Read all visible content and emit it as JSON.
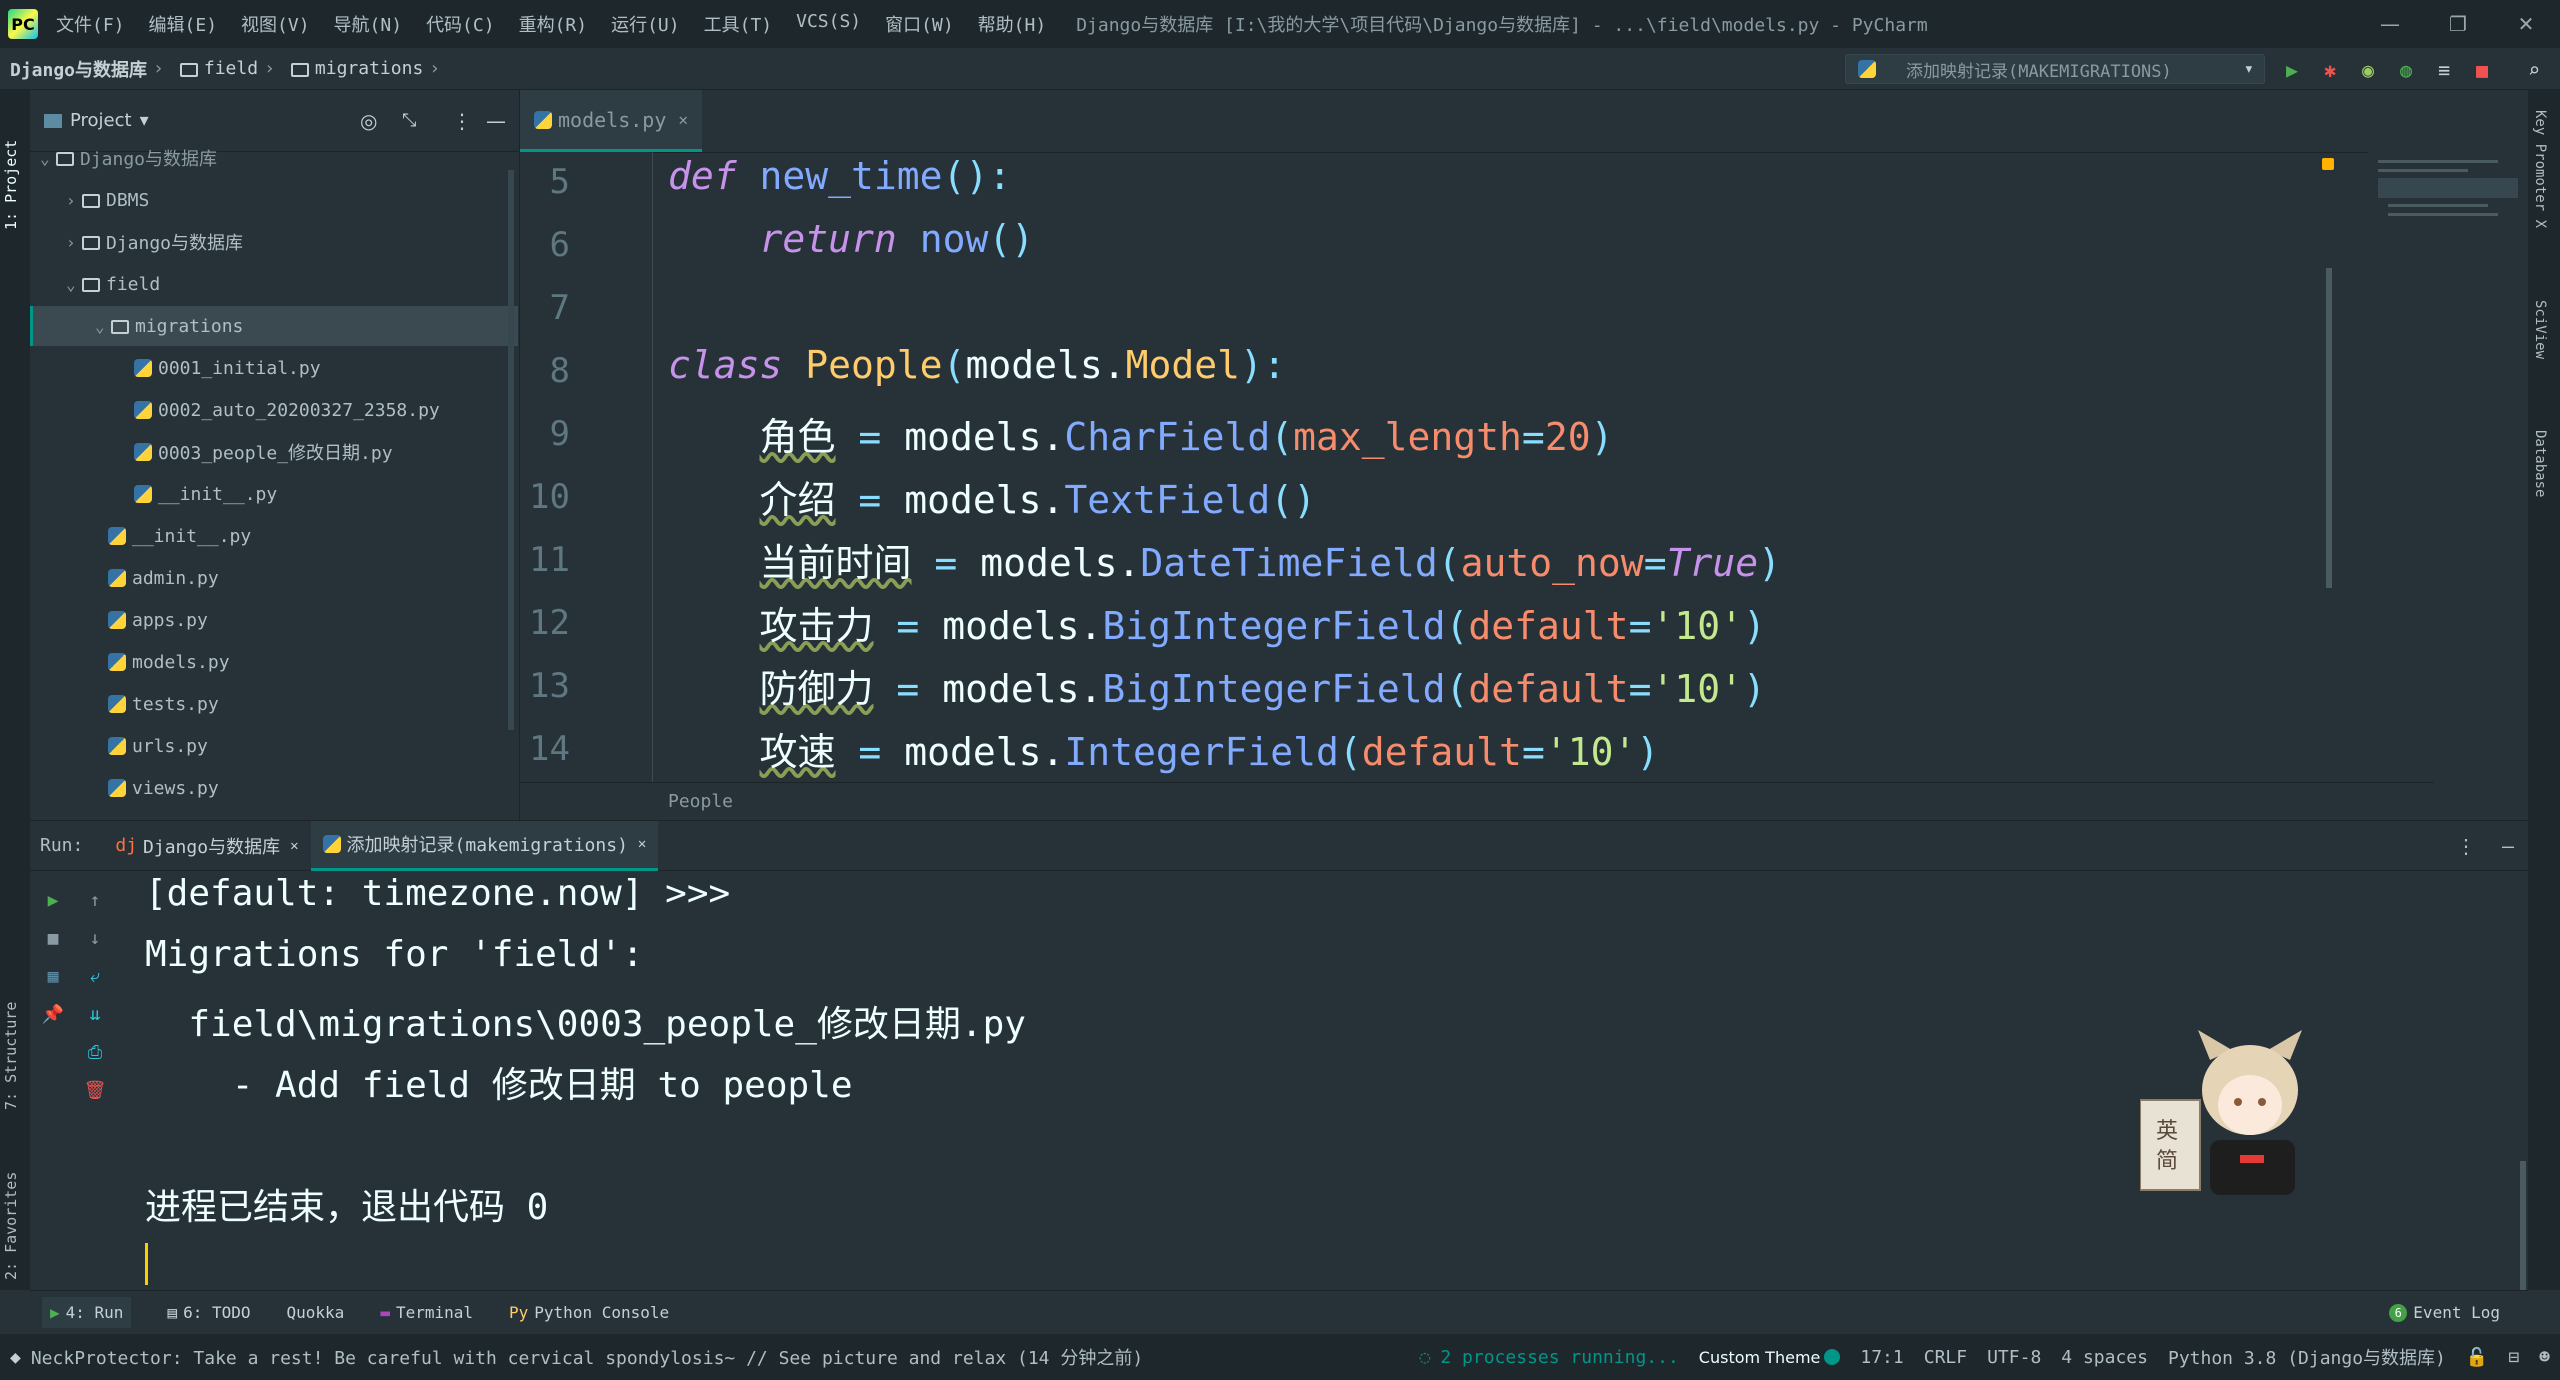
{
  "titlebar": {
    "menus": [
      "文件(F)",
      "编辑(E)",
      "视图(V)",
      "导航(N)",
      "代码(C)",
      "重构(R)",
      "运行(U)",
      "工具(T)",
      "VCS(S)",
      "窗口(W)",
      "帮助(H)"
    ],
    "title": "Django与数据库 [I:\\我的大学\\项目代码\\Django与数据库] - ...\\field\\models.py - PyCharm",
    "btn_min": "—",
    "btn_max": "❐",
    "btn_close": "✕"
  },
  "navbar": {
    "crumbs": [
      "Django与数据库",
      "field",
      "migrations"
    ],
    "run_config": "添加映射记录(MAKEMIGRATIONS)"
  },
  "left_strip": {
    "project_tab": "1: Project",
    "structure_tab": "7: Structure",
    "favorites_tab": "2: Favorites"
  },
  "right_strip": {
    "key_promoter": "Key Promoter X",
    "sciview": "SciView",
    "database": "Database"
  },
  "project": {
    "header": "Project",
    "root": "Django与数据库",
    "items": [
      {
        "label": "DBMS",
        "type": "folder",
        "level": 1,
        "open": false
      },
      {
        "label": "Django与数据库",
        "type": "folder",
        "level": 1,
        "open": false
      },
      {
        "label": "field",
        "type": "folder",
        "level": 1,
        "open": true
      },
      {
        "label": "migrations",
        "type": "folder",
        "level": 2,
        "open": true,
        "selected": true
      },
      {
        "label": "0001_initial.py",
        "type": "py",
        "level": 3
      },
      {
        "label": "0002_auto_20200327_2358.py",
        "type": "py",
        "level": 3
      },
      {
        "label": "0003_people_修改日期.py",
        "type": "py",
        "level": 3
      },
      {
        "label": "__init__.py",
        "type": "py",
        "level": 3
      },
      {
        "label": "__init__.py",
        "type": "py",
        "level": 2
      },
      {
        "label": "admin.py",
        "type": "py",
        "level": 2
      },
      {
        "label": "apps.py",
        "type": "py",
        "level": 2
      },
      {
        "label": "models.py",
        "type": "py",
        "level": 2
      },
      {
        "label": "tests.py",
        "type": "py",
        "level": 2
      },
      {
        "label": "urls.py",
        "type": "py",
        "level": 2
      },
      {
        "label": "views.py",
        "type": "py",
        "level": 2
      }
    ]
  },
  "editor": {
    "tab": "models.py",
    "line_numbers": [
      "5",
      "6",
      "7",
      "8",
      "9",
      "10",
      "11",
      "12",
      "13",
      "14"
    ],
    "breadcrumb": "People"
  },
  "run": {
    "label": "Run:",
    "tabs": [
      "Django与数据库",
      "添加映射记录(makemigrations)"
    ],
    "output": [
      "[default: timezone.now] >>>",
      "Migrations for 'field':",
      "  field\\migrations\\0003_people_修改日期.py",
      "    - Add field 修改日期 to people",
      "",
      "进程已结束，退出代码 0"
    ]
  },
  "bottom_tabs": {
    "run": "4: Run",
    "todo": "6: TODO",
    "quokka": "Quokka",
    "terminal": "Terminal",
    "python_console": "Python Console",
    "event_log": "Event Log",
    "event_count": "6"
  },
  "status": {
    "message": "NeckProtector: Take a rest! Be careful with cervical spondylosis~ // See picture and relax (14 分钟之前)",
    "processes": "2 processes running...",
    "theme": "Custom Theme",
    "position": "17:1",
    "line_sep": "CRLF",
    "encoding": "UTF-8",
    "indent": "4 spaces",
    "interpreter": "Python 3.8 (Django与数据库)"
  },
  "mascot": {
    "sign_chars": "英简"
  },
  "colors": {
    "accent": "#009688",
    "bg": "#263238",
    "keyword": "#c792ea",
    "function": "#82aaff",
    "class": "#ffcb6b",
    "string": "#c3e88d",
    "param": "#f78c6c"
  }
}
